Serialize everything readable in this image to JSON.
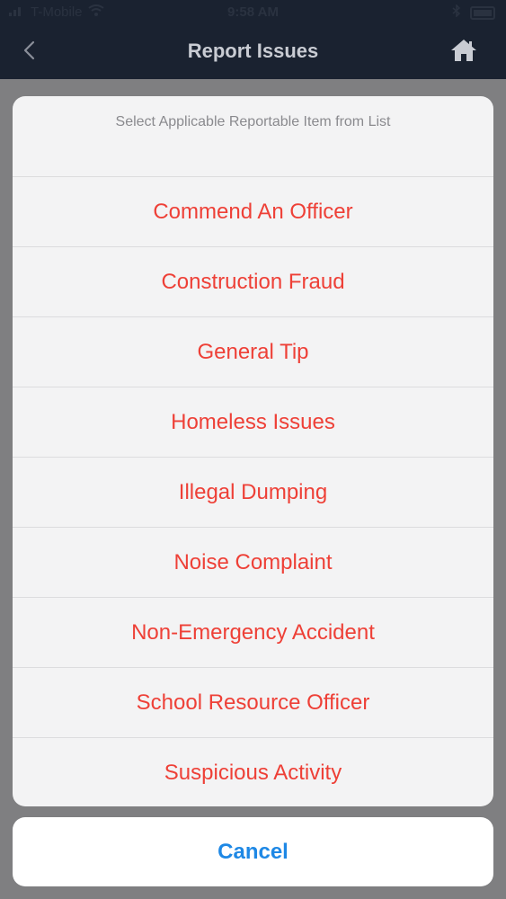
{
  "status_bar": {
    "carrier": "T-Mobile",
    "time": "9:58 AM"
  },
  "nav": {
    "title": "Report Issues"
  },
  "sheet": {
    "header": "Select Applicable Reportable Item from List",
    "items": [
      "Commend An Officer",
      "Construction Fraud",
      "General Tip",
      "Homeless Issues",
      "Illegal Dumping",
      "Noise Complaint",
      "Non-Emergency Accident",
      "School Resource Officer",
      "Suspicious Activity"
    ],
    "cancel_label": "Cancel"
  },
  "colors": {
    "nav_background": "#1a2230",
    "item_text": "#ee4037",
    "cancel_text": "#1e88e5",
    "dim_overlay": "#7f7f81"
  }
}
